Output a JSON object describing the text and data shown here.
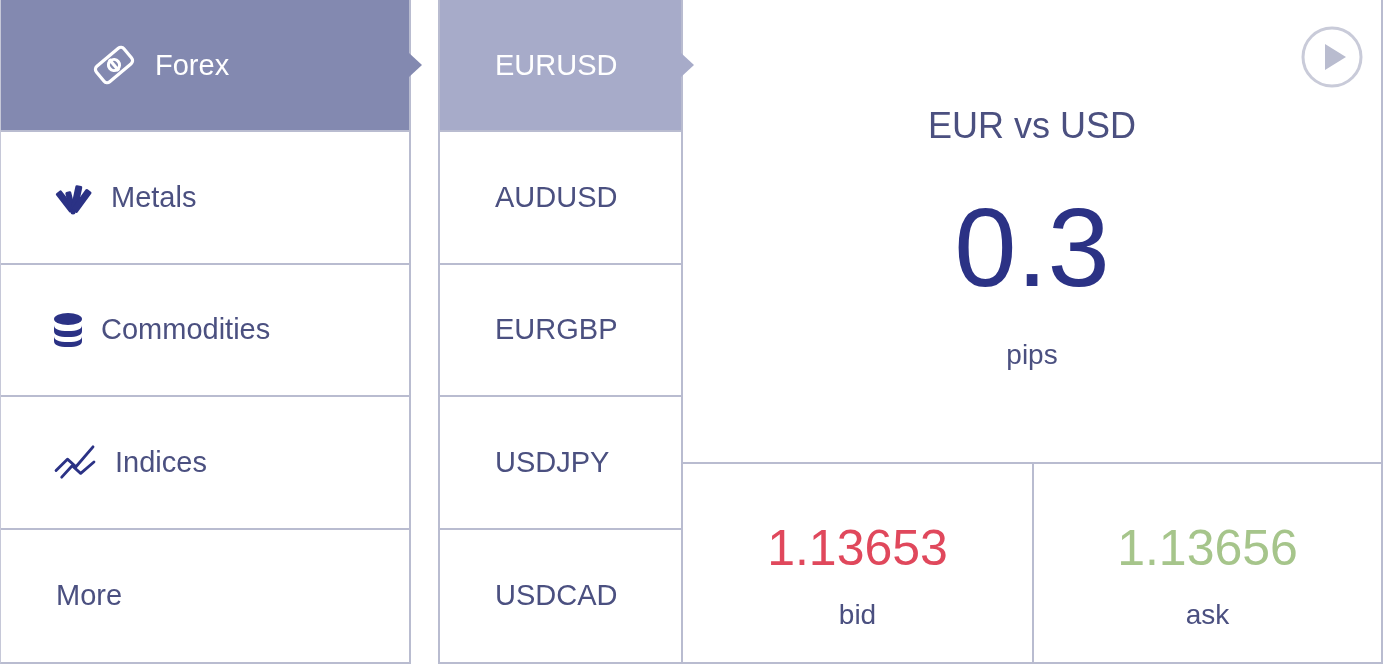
{
  "categories": [
    {
      "label": "Forex",
      "selected": true
    },
    {
      "label": "Metals",
      "selected": false
    },
    {
      "label": "Commodities",
      "selected": false
    },
    {
      "label": "Indices",
      "selected": false
    },
    {
      "label": "More",
      "selected": false
    }
  ],
  "pairs": [
    {
      "label": "EURUSD",
      "selected": true
    },
    {
      "label": "AUDUSD",
      "selected": false
    },
    {
      "label": "EURGBP",
      "selected": false
    },
    {
      "label": "USDJPY",
      "selected": false
    },
    {
      "label": "USDCAD",
      "selected": false
    }
  ],
  "quote": {
    "title": "EUR vs USD",
    "spread": "0.3",
    "spread_unit": "pips",
    "prices": [
      {
        "value": "1.13653",
        "label": "bid",
        "color": "#e0485c"
      },
      {
        "value": "1.13656",
        "label": "ask",
        "color": "#a6c58b"
      }
    ]
  }
}
